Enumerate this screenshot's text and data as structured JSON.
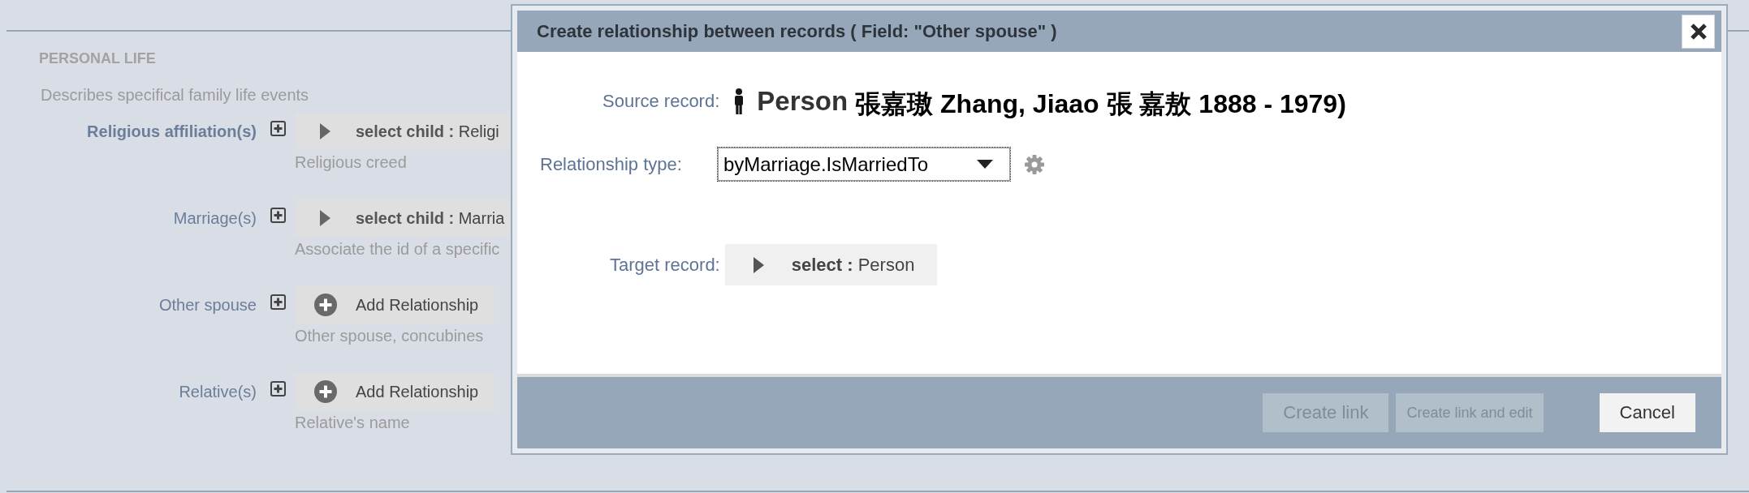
{
  "section": {
    "title": "PERSONAL LIFE",
    "description": "Describes specifical family life events"
  },
  "fields": [
    {
      "label": "Religious affiliation(s)",
      "emphasized": true,
      "control": {
        "kind": "select",
        "action": "select child :",
        "value": "Religi"
      },
      "help": "Religious creed"
    },
    {
      "label": "Marriage(s)",
      "emphasized": false,
      "control": {
        "kind": "select",
        "action": "select child :",
        "value": "Marria"
      },
      "help": "Associate the id of a specific"
    },
    {
      "label": "Other spouse",
      "emphasized": false,
      "control": {
        "kind": "add",
        "label": "Add Relationship"
      },
      "help": "Other spouse, concubines"
    },
    {
      "label": "Relative(s)",
      "emphasized": false,
      "control": {
        "kind": "add",
        "label": "Add Relationship"
      },
      "help": "Relative's name"
    }
  ],
  "dialog": {
    "title": "Create relationship between records ( Field: \"Other spouse\" )",
    "source_record": {
      "label": "Source record:",
      "type": "Person",
      "name": "張嘉璈 Zhang, Jiaao 張 嘉敖 1888 - 1979)"
    },
    "relationship_type": {
      "label": "Relationship type:",
      "value": "byMarriage.IsMarriedTo",
      "focused": true
    },
    "target_record": {
      "label": "Target record:",
      "action": "select :",
      "value": "Person"
    },
    "buttons": [
      {
        "label": "Create link",
        "disabled": true
      },
      {
        "label": "Create link and edit",
        "disabled": true
      },
      {
        "label": "Cancel",
        "disabled": false
      }
    ]
  }
}
